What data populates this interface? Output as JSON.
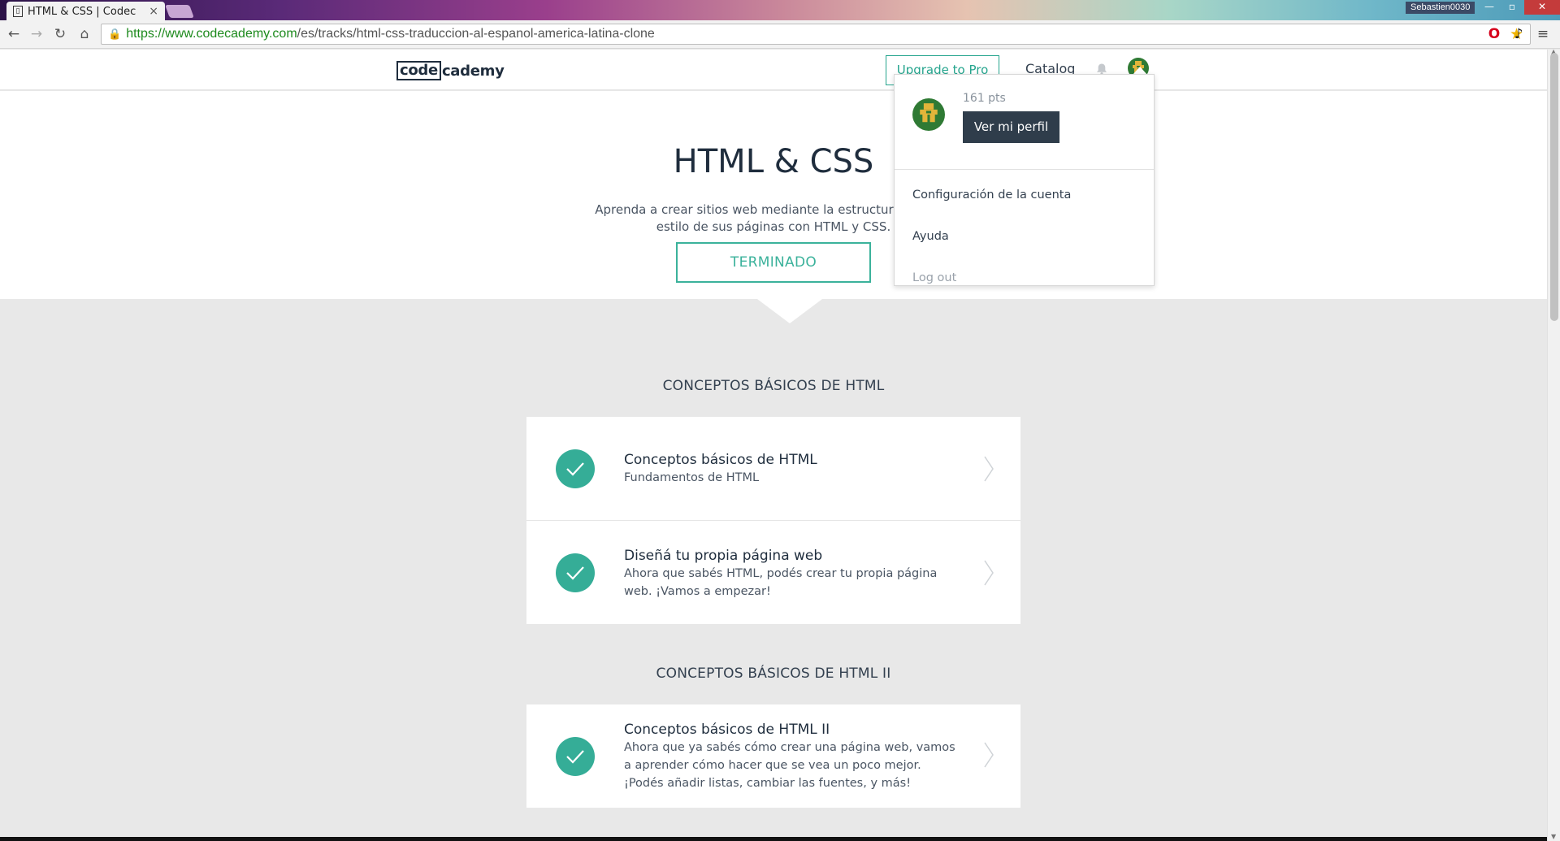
{
  "browser": {
    "tab_title": "HTML & CSS | Codec",
    "tab_favicon": "codecademy-favicon",
    "user_badge": "Sebastien0030",
    "url_green": "https://",
    "url_domain": "www.codecademy.com",
    "url_path": "/es/tracks/html-css-traduccion-al-espanol-america-latina-clone",
    "controls": {
      "minimize": "—",
      "maximize": "▫",
      "close": "✕"
    }
  },
  "header": {
    "logo_box": "code",
    "logo_rest": "cademy",
    "upgrade_label": "Upgrade to Pro",
    "catalog_label": "Catalog"
  },
  "hero": {
    "title": "HTML & CSS",
    "description": "Aprenda a crear sitios web mediante la estructuración y el estilo de sus páginas con HTML y CSS.",
    "status_button": "TERMINADO"
  },
  "sections": [
    {
      "title": "CONCEPTOS BÁSICOS DE HTML",
      "items": [
        {
          "title": "Conceptos básicos de HTML",
          "subtitle": "Fundamentos de HTML"
        },
        {
          "title": "Diseñá tu propia página web",
          "subtitle": "Ahora que sabés HTML, podés crear tu propia página web. ¡Vamos a empezar!"
        }
      ]
    },
    {
      "title": "CONCEPTOS BÁSICOS DE HTML II",
      "items": [
        {
          "title": "Conceptos básicos de HTML II",
          "subtitle": "Ahora que ya sabés cómo crear una página web, vamos a aprender cómo hacer que se vea un poco mejor. ¡Podés añadir listas, cambiar las fuentes, y más!"
        }
      ]
    }
  ],
  "dropdown": {
    "points": "161 pts",
    "profile_button": "Ver mi perfil",
    "items": [
      "Configuración de la cuenta",
      "Ayuda",
      "Log out"
    ]
  },
  "colors": {
    "accent": "#35ad97",
    "dark": "#2f3d4b",
    "background": "#e8e8e8"
  }
}
